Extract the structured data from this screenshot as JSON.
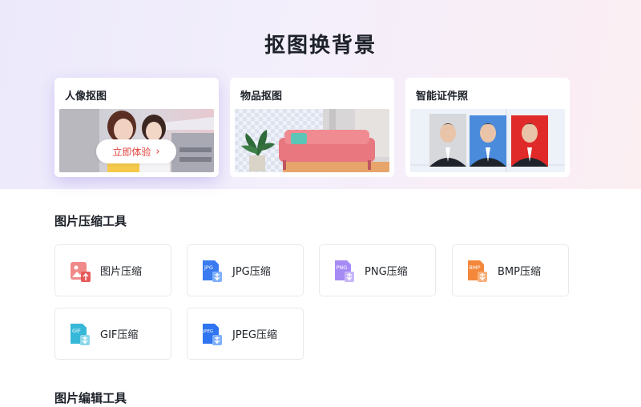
{
  "hero": {
    "title": "抠图换背景",
    "cards": [
      {
        "title": "人像抠图",
        "button": "立即体验"
      },
      {
        "title": "物品抠图"
      },
      {
        "title": "智能证件照"
      }
    ]
  },
  "sections": {
    "compress_title": "图片压缩工具",
    "edit_title": "图片编辑工具"
  },
  "tools": [
    {
      "label": "图片压缩",
      "icon_text": ""
    },
    {
      "label": "JPG压缩",
      "icon_text": "JPG"
    },
    {
      "label": "PNG压缩",
      "icon_text": "PNG"
    },
    {
      "label": "BMP压缩",
      "icon_text": "BMP"
    },
    {
      "label": "GIF压缩",
      "icon_text": "GIF"
    },
    {
      "label": "JPEG压缩",
      "icon_text": "JPEG"
    }
  ],
  "colors": {
    "accent_red": "#e0403c",
    "jpg_blue": "#3a7cf0",
    "png_purple": "#9b7cf2",
    "bmp_orange": "#f3873a",
    "gif_cyan": "#37b8d8",
    "jpeg_blue": "#2f74f0"
  }
}
